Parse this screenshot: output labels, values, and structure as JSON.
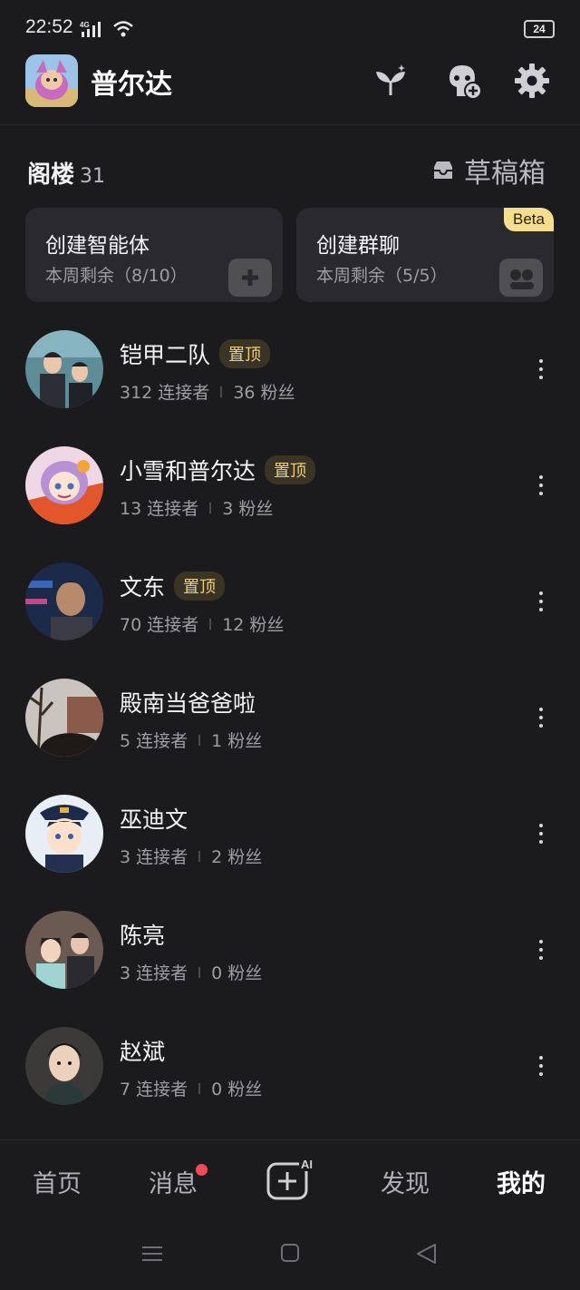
{
  "status": {
    "time": "22:52",
    "network": "4G",
    "battery": "24"
  },
  "header": {
    "name": "普尔达"
  },
  "section": {
    "title": "阁楼",
    "count": "31",
    "drafts_label": "草稿箱"
  },
  "cards": [
    {
      "title": "创建智能体",
      "sub": "本周剩余（8/10）"
    },
    {
      "title": "创建群聊",
      "sub": "本周剩余（5/5）",
      "badge": "Beta"
    }
  ],
  "pin_label": "置顶",
  "rows": [
    {
      "name": "铠甲二队",
      "pinned": true,
      "connectors": "312 连接者",
      "fans": "36 粉丝"
    },
    {
      "name": "小雪和普尔达",
      "pinned": true,
      "connectors": "13 连接者",
      "fans": "3 粉丝"
    },
    {
      "name": "文东",
      "pinned": true,
      "connectors": "70 连接者",
      "fans": "12 粉丝"
    },
    {
      "name": "殿南当爸爸啦",
      "pinned": false,
      "connectors": "5 连接者",
      "fans": "1 粉丝"
    },
    {
      "name": "巫迪文",
      "pinned": false,
      "connectors": "3 连接者",
      "fans": "2 粉丝"
    },
    {
      "name": "陈亮",
      "pinned": false,
      "connectors": "3 连接者",
      "fans": "0 粉丝"
    },
    {
      "name": "赵斌",
      "pinned": false,
      "connectors": "7 连接者",
      "fans": "0 粉丝"
    }
  ],
  "nav": {
    "home": "首页",
    "messages": "消息",
    "ai_badge": "AI",
    "discover": "发现",
    "me": "我的"
  },
  "colors": {
    "background": "#1b1b1e",
    "card": "#2a2a2e",
    "pin_text": "#f1cd7e",
    "beta_bg": "#f7dd8e",
    "notify_dot": "#f24a5a"
  }
}
